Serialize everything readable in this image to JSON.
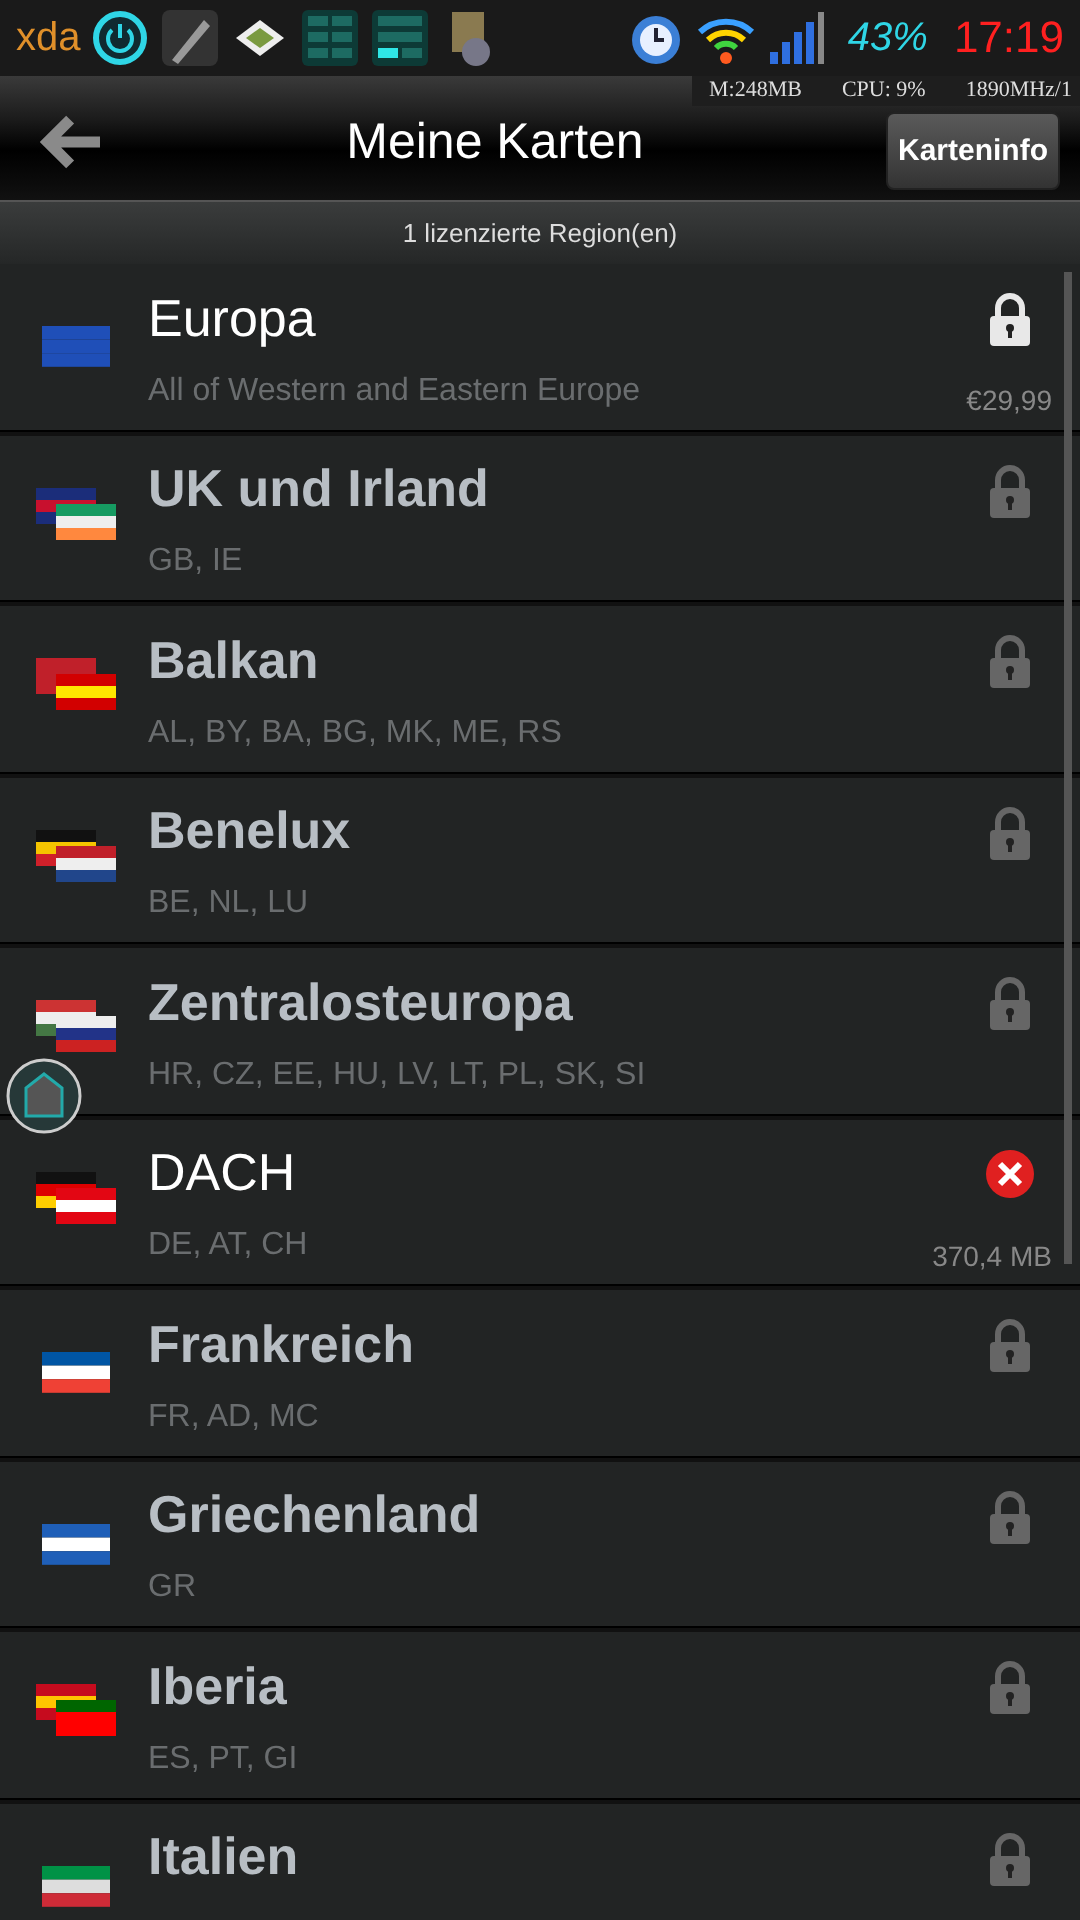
{
  "status_bar": {
    "logo": "xda",
    "battery": "43%",
    "time": "17:19"
  },
  "system_overlay": {
    "memory": "M:248MB",
    "cpu": "CPU: 9%",
    "frequency": "1890MHz/1"
  },
  "header": {
    "title": "Meine Karten",
    "button": "Karteninfo"
  },
  "subtitle": "1 lizenzierte Region(en)",
  "regions": [
    {
      "name": "Europa",
      "codes": "All of Western and Eastern Europe",
      "kind": "lock",
      "active": true,
      "note": "€29,99"
    },
    {
      "name": "UK und Irland",
      "codes": "GB, IE",
      "kind": "lock",
      "active": false
    },
    {
      "name": "Balkan",
      "codes": "AL, BY, BA, BG, MK, ME, RS",
      "kind": "lock",
      "active": false
    },
    {
      "name": "Benelux",
      "codes": "BE, NL, LU",
      "kind": "lock",
      "active": false
    },
    {
      "name": "Zentralosteuropa",
      "codes": "HR, CZ, EE, HU, LV, LT, PL, SK, SI",
      "kind": "lock",
      "active": false
    },
    {
      "name": "DACH",
      "codes": "DE, AT, CH",
      "kind": "delete",
      "active": true,
      "note": "370,4 MB"
    },
    {
      "name": "Frankreich",
      "codes": "FR, AD, MC",
      "kind": "lock",
      "active": false
    },
    {
      "name": "Griechenland",
      "codes": "GR",
      "kind": "lock",
      "active": false
    },
    {
      "name": "Iberia",
      "codes": "ES, PT, GI",
      "kind": "lock",
      "active": false
    },
    {
      "name": "Italien",
      "kind": "lock",
      "active": false
    }
  ]
}
